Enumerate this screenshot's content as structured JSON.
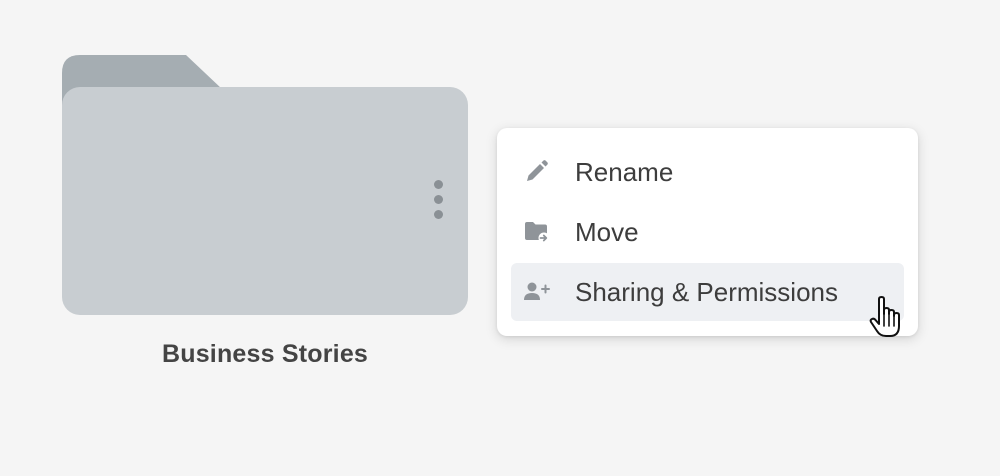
{
  "colors": {
    "background": "#f5f5f5",
    "folder_body": "#c8cdd1",
    "folder_tab": "#a5adb2",
    "menu_bg": "#ffffff",
    "menu_hover": "#eef0f3",
    "text": "#3d3d3d",
    "icon": "#8f9499"
  },
  "folder": {
    "name": "Business Stories",
    "icon": "folder-icon",
    "more_icon": "kebab-menu-icon"
  },
  "context_menu": {
    "items": [
      {
        "label": "Rename",
        "icon": "pencil-icon",
        "hovered": false
      },
      {
        "label": "Move",
        "icon": "folder-move-icon",
        "hovered": false
      },
      {
        "label": "Sharing & Permissions",
        "icon": "add-user-icon",
        "hovered": true
      }
    ]
  },
  "cursor": {
    "type": "hand-pointer-icon"
  }
}
